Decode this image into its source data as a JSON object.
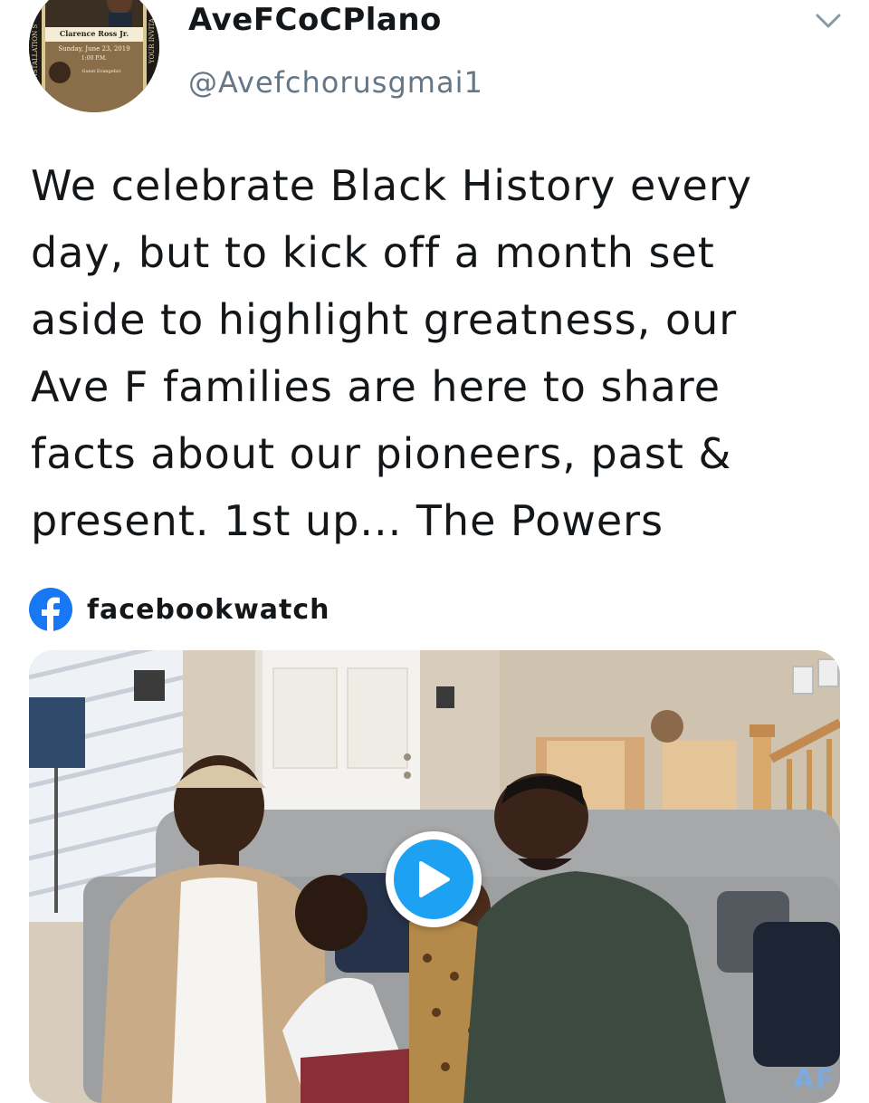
{
  "author": {
    "display_name": "AveFCoCPlano",
    "handle": "@Avefchorusgmai1",
    "avatar": {
      "lines": [
        "Clarence Ross Jr.",
        "Sunday, June 23, 2019",
        "1:00 P.M.",
        "Guest Evangelist"
      ],
      "side_left": "INSTALLATION S",
      "side_right": "YOUR INVITA"
    }
  },
  "tweet": {
    "lines": [
      "We celebrate Black History every",
      "day, but to kick off a month set",
      "aside to highlight greatness, our",
      "Ave F families are here to share",
      "facts about our pioneers, past &",
      "present. 1st up... The Powers"
    ]
  },
  "source": {
    "icon": "facebook-icon",
    "label": "facebookwatch"
  },
  "media": {
    "type": "video",
    "play_icon": "play-icon",
    "watermark": "AF"
  },
  "menu": {
    "icon": "chevron-down-icon"
  },
  "colors": {
    "accent": "#1da1f2",
    "facebook": "#1877f2",
    "text": "#14171a",
    "muted": "#657786"
  }
}
